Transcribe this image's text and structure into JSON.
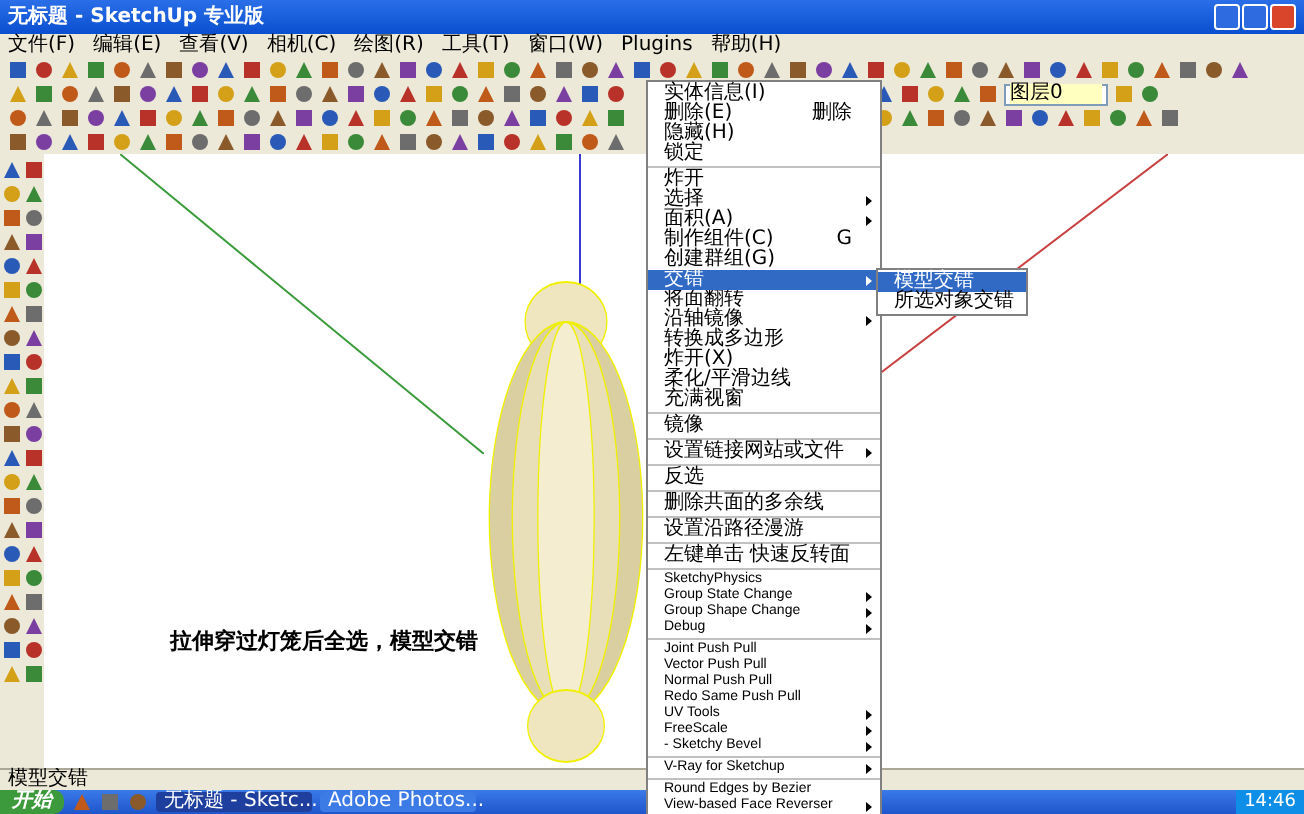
{
  "window": {
    "title": "无标题 - SketchUp 专业版"
  },
  "menu_bar": [
    "文件(F)",
    "编辑(E)",
    "查看(V)",
    "相机(C)",
    "绘图(R)",
    "工具(T)",
    "窗口(W)",
    "Plugins",
    "帮助(H)"
  ],
  "layer_dropdown": {
    "value": "图层0"
  },
  "canvas": {
    "annotation": "拉伸穿过灯笼后全选，模型交错"
  },
  "context_menu": {
    "groups": [
      [
        {
          "label": "实体信息(I)",
          "selected": false,
          "submenu": false
        },
        {
          "label": "删除(E)",
          "shortcut": "删除",
          "selected": false,
          "submenu": false
        },
        {
          "label": "隐藏(H)",
          "selected": false,
          "submenu": false
        },
        {
          "label": "锁定",
          "selected": false,
          "submenu": false
        }
      ],
      [
        {
          "label": "炸开",
          "selected": false,
          "submenu": false
        },
        {
          "label": "选择",
          "selected": false,
          "submenu": true
        },
        {
          "label": "面积(A)",
          "selected": false,
          "submenu": true
        },
        {
          "label": "制作组件(C)",
          "shortcut": "G",
          "selected": false,
          "submenu": false
        },
        {
          "label": "创建群组(G)",
          "selected": false,
          "submenu": false
        },
        {
          "label": "交错",
          "selected": true,
          "submenu": true
        },
        {
          "label": "将面翻转",
          "selected": false,
          "submenu": false
        },
        {
          "label": "沿轴镜像",
          "selected": false,
          "submenu": true
        },
        {
          "label": "转换成多边形",
          "selected": false,
          "submenu": false
        },
        {
          "label": "炸开(X)",
          "selected": false,
          "submenu": false
        },
        {
          "label": "柔化/平滑边线",
          "selected": false,
          "submenu": false
        },
        {
          "label": "充满视窗",
          "selected": false,
          "submenu": false
        }
      ],
      [
        {
          "label": "镜像",
          "selected": false,
          "submenu": false
        }
      ],
      [
        {
          "label": "设置链接网站或文件",
          "selected": false,
          "submenu": true
        }
      ],
      [
        {
          "label": "反选",
          "selected": false,
          "submenu": false
        }
      ],
      [
        {
          "label": "删除共面的多余线",
          "selected": false,
          "submenu": false
        }
      ],
      [
        {
          "label": "设置沿路径漫游",
          "selected": false,
          "submenu": false
        }
      ],
      [
        {
          "label": "左键单击 快速反转面",
          "selected": false,
          "submenu": false
        }
      ],
      [
        {
          "label": "SketchyPhysics",
          "selected": false,
          "submenu": false
        },
        {
          "label": "Group State Change",
          "selected": false,
          "submenu": true
        },
        {
          "label": "Group Shape Change",
          "selected": false,
          "submenu": true
        },
        {
          "label": "Debug",
          "selected": false,
          "submenu": true
        }
      ],
      [
        {
          "label": "Joint Push Pull",
          "selected": false,
          "submenu": false
        },
        {
          "label": "Vector Push Pull",
          "selected": false,
          "submenu": false
        },
        {
          "label": "Normal Push Pull",
          "selected": false,
          "submenu": false
        },
        {
          "label": "Redo Same Push Pull",
          "selected": false,
          "submenu": false
        },
        {
          "label": "UV Tools",
          "selected": false,
          "submenu": true
        },
        {
          "label": "FreeScale",
          "selected": false,
          "submenu": true
        },
        {
          "label": "- Sketchy Bevel",
          "selected": false,
          "submenu": true
        }
      ],
      [
        {
          "label": "V-Ray for Sketchup",
          "selected": false,
          "submenu": true
        }
      ],
      [
        {
          "label": "Round Edges by Bezier",
          "selected": false,
          "submenu": false
        },
        {
          "label": "View-based Face Reverser",
          "selected": false,
          "submenu": true
        }
      ]
    ]
  },
  "submenu": [
    {
      "label": "模型交错",
      "selected": true
    },
    {
      "label": "所选对象交错",
      "selected": false
    }
  ],
  "status_bar": {
    "text": "模型交错"
  },
  "taskbar": {
    "start": "开始",
    "tasks": [
      {
        "label": "无标题 - Sketc...",
        "selected": true
      },
      {
        "label": "Adobe Photos...",
        "selected": false
      }
    ],
    "clock": "14:46"
  }
}
